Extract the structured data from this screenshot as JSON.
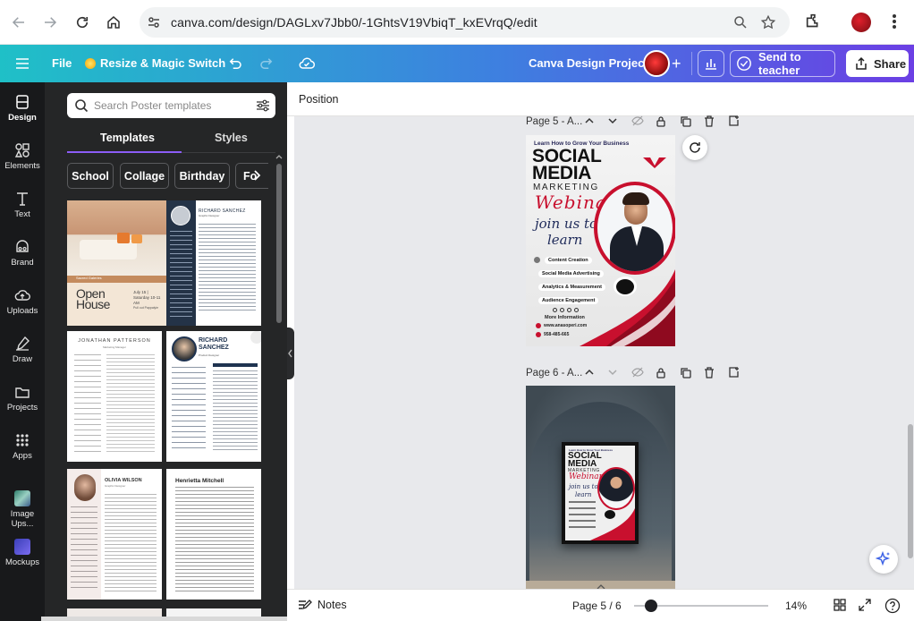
{
  "browser": {
    "url": "canva.com/design/DAGLxv7Jbb0/-1GhtsV19VbiqT_kxEVrqQ/edit"
  },
  "topbar": {
    "file_label": "File",
    "resize_label": "Resize & Magic Switch",
    "project_title": "Canva Design Project",
    "send_label": "Send to teacher",
    "share_label": "Share",
    "gradient": [
      "#1fc0c7",
      "#3e7fe0",
      "#6b3fe4"
    ]
  },
  "rail": {
    "items": [
      {
        "label": "Design",
        "icon": "design-icon",
        "active": true
      },
      {
        "label": "Elements",
        "icon": "elements-icon"
      },
      {
        "label": "Text",
        "icon": "text-icon"
      },
      {
        "label": "Brand",
        "icon": "brand-icon"
      },
      {
        "label": "Uploads",
        "icon": "uploads-icon"
      },
      {
        "label": "Draw",
        "icon": "draw-icon"
      },
      {
        "label": "Projects",
        "icon": "projects-icon"
      },
      {
        "label": "Apps",
        "icon": "apps-icon"
      },
      {
        "label": "Image Ups...",
        "icon": "image-upscaler-icon"
      },
      {
        "label": "Mockups",
        "icon": "mockups-icon"
      }
    ]
  },
  "panel": {
    "search_placeholder": "Search Poster templates",
    "tabs": [
      "Templates",
      "Styles"
    ],
    "chips": [
      "School",
      "Collage",
      "Birthday",
      "Fo"
    ],
    "templates": [
      {
        "title": "Open House",
        "subtitle": "July 15 | Saturday 10-11 AM",
        "caption": "Sacred Galeries",
        "footer": "Pull out Pappalyie"
      },
      {
        "name": "RICHARD SANCHEZ",
        "role": "Graphic Designer",
        "style": "dark-sidebar-resume"
      },
      {
        "name": "JONATHAN PATTERSON",
        "role": "Marketing Manager",
        "style": "minimal-resume"
      },
      {
        "name": "RICHARD SANCHEZ",
        "role": "Product Designer",
        "style": "photo-resume"
      },
      {
        "name": "OLIVIA WILSON",
        "role": "Graphic Designer",
        "style": "photo-left-resume"
      },
      {
        "name": "Henrietta Mitchell",
        "role": "",
        "style": "text-resume"
      }
    ]
  },
  "workspace": {
    "position_label": "Position",
    "pages": [
      {
        "label": "Page 5 - A..."
      },
      {
        "label": "Page 6 - A..."
      }
    ]
  },
  "poster": {
    "headline_small": "Learn How to Grow Your Business",
    "title_line1": "SOCIAL",
    "title_line2": "MEDIA",
    "title_line3": "MARKETING",
    "script_word": "Webinar",
    "join_line1": "join us to",
    "join_line2": "learn",
    "bullets": [
      "Content Creation",
      "Social Media Advertising",
      "Analytics & Measurement",
      "Audience Engagement"
    ],
    "more_info": "More Information",
    "website": "www.anasoperi.com",
    "phone": "958-485-665",
    "accent": "#c8102e"
  },
  "bottombar": {
    "notes_label": "Notes",
    "page_indicator": "Page 5 / 6",
    "zoom_value": "14%",
    "zoom_fraction": 0.14
  }
}
